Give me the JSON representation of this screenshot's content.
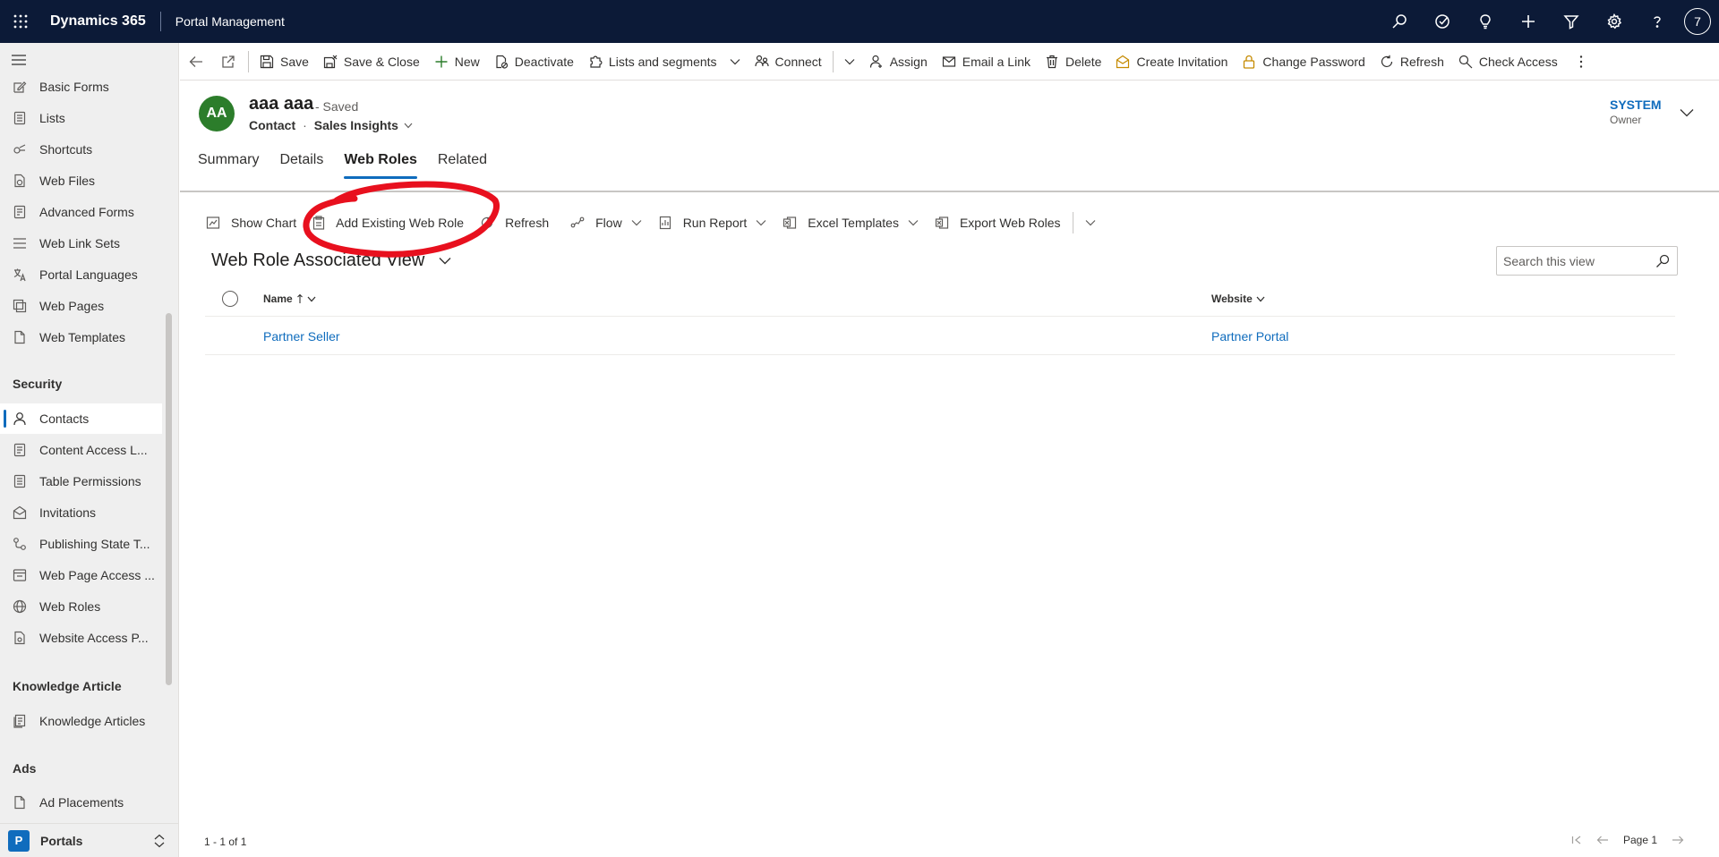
{
  "topbar": {
    "brand": "Dynamics 365",
    "app_name": "Portal Management",
    "profile_initial": "7",
    "icons": [
      "search-icon",
      "task-check-icon",
      "lightbulb-icon",
      "plus-icon",
      "filter-icon",
      "gear-icon",
      "help-icon"
    ]
  },
  "sidebar": {
    "items_top": [
      {
        "label": "Basic Forms",
        "icon": "form-icon"
      },
      {
        "label": "Lists",
        "icon": "list-icon"
      },
      {
        "label": "Shortcuts",
        "icon": "shortcut-icon"
      },
      {
        "label": "Web Files",
        "icon": "web-file-icon"
      },
      {
        "label": "Advanced Forms",
        "icon": "form-icon"
      },
      {
        "label": "Web Link Sets",
        "icon": "list-icon"
      },
      {
        "label": "Portal Languages",
        "icon": "language-icon"
      },
      {
        "label": "Web Pages",
        "icon": "web-page-icon"
      },
      {
        "label": "Web Templates",
        "icon": "document-icon"
      }
    ],
    "security_group": "Security",
    "security_items": [
      {
        "label": "Contacts",
        "icon": "person-icon",
        "active": true
      },
      {
        "label": "Content Access L...",
        "icon": "document-icon"
      },
      {
        "label": "Table Permissions",
        "icon": "document-icon"
      },
      {
        "label": "Invitations",
        "icon": "invitation-icon"
      },
      {
        "label": "Publishing State T...",
        "icon": "flow-icon"
      },
      {
        "label": "Web Page Access ...",
        "icon": "web-page-icon"
      },
      {
        "label": "Web Roles",
        "icon": "globe-icon"
      },
      {
        "label": "Website Access P...",
        "icon": "document-icon"
      }
    ],
    "knowledge_group": "Knowledge Article",
    "knowledge_items": [
      {
        "label": "Knowledge Articles",
        "icon": "article-icon"
      }
    ],
    "ads_group": "Ads",
    "ads_items": [
      {
        "label": "Ad Placements",
        "icon": "ad-icon"
      }
    ],
    "area": {
      "badge": "P",
      "name": "Portals"
    }
  },
  "commandbar": {
    "save": "Save",
    "save_close": "Save & Close",
    "new": "New",
    "deactivate": "Deactivate",
    "lists_segments": "Lists and segments",
    "connect": "Connect",
    "assign": "Assign",
    "email_link": "Email a Link",
    "delete": "Delete",
    "create_invitation": "Create Invitation",
    "change_password": "Change Password",
    "refresh": "Refresh",
    "check_access": "Check Access"
  },
  "header": {
    "avatar_initials": "AA",
    "record_name": "aaa aaa",
    "saved_status": "- Saved",
    "entity": "Contact",
    "form_name": "Sales Insights",
    "owner_name": "SYSTEM",
    "owner_label": "Owner"
  },
  "tabs": [
    {
      "label": "Summary",
      "active": false
    },
    {
      "label": "Details",
      "active": false
    },
    {
      "label": "Web Roles",
      "active": true
    },
    {
      "label": "Related",
      "active": false
    }
  ],
  "subgrid": {
    "commands": {
      "show_chart": "Show Chart",
      "add_existing": "Add Existing Web Role",
      "refresh": "Refresh",
      "flow": "Flow",
      "run_report": "Run Report",
      "excel_templates": "Excel Templates",
      "export": "Export Web Roles"
    },
    "view_title": "Web Role Associated View",
    "search_placeholder": "Search this view",
    "columns": {
      "name": "Name",
      "website": "Website"
    },
    "rows": [
      {
        "name": "Partner Seller",
        "website": "Partner Portal"
      }
    ],
    "record_count": "1 - 1 of 1",
    "page_label": "Page 1"
  },
  "colors": {
    "topbar": "#0c1a37",
    "accent": "#0f6cbd",
    "annotation": "#e8101e",
    "avatar": "#2c7d2b"
  }
}
